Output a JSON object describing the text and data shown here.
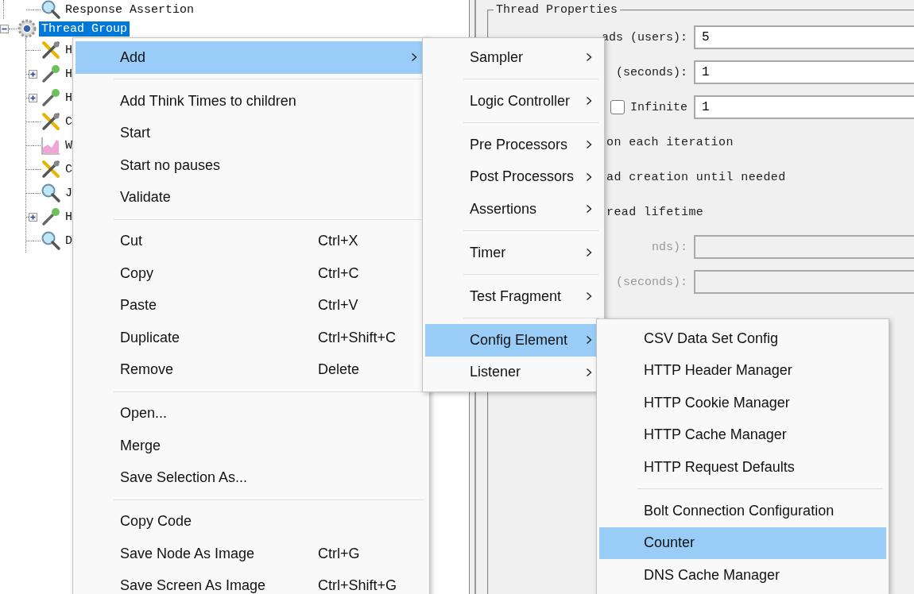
{
  "tree": {
    "partial_branch": [
      {
        "label": "Response Assertion",
        "kind": "magnifier",
        "selected": false
      }
    ],
    "nodes": [
      {
        "label": "Thread Group",
        "kind": "gear",
        "selected": true,
        "expanded": true,
        "children": [
          {
            "label": "H",
            "kind": "tools",
            "selected": false
          },
          {
            "label": "H",
            "kind": "dropper",
            "selected": false,
            "expanded": false
          },
          {
            "label": "H",
            "kind": "dropper",
            "selected": false,
            "expanded": false
          },
          {
            "label": "C",
            "kind": "tools",
            "selected": false
          },
          {
            "label": "W",
            "kind": "chart",
            "selected": false
          },
          {
            "label": "C",
            "kind": "tools",
            "selected": false
          },
          {
            "label": "J",
            "kind": "magnifier",
            "selected": false
          },
          {
            "label": "H",
            "kind": "dropper",
            "selected": false,
            "expanded": false
          },
          {
            "label": "D",
            "kind": "magnifier",
            "selected": false
          }
        ]
      }
    ]
  },
  "properties": {
    "title": "Thread Properties",
    "rows": [
      {
        "kind": "field",
        "label": "ads (users):",
        "value": "5",
        "disabled": false
      },
      {
        "kind": "field",
        "label": "(seconds):",
        "value": "1",
        "disabled": false
      },
      {
        "kind": "checkfield",
        "label": "Infinite",
        "checked": false,
        "value": "1",
        "disabled": false
      },
      {
        "kind": "text",
        "label": "on each iteration"
      },
      {
        "kind": "text",
        "label": "ad creation until needed"
      },
      {
        "kind": "text",
        "label": "read lifetime"
      },
      {
        "kind": "field",
        "label": "nds):",
        "disabled": true
      },
      {
        "kind": "field",
        "label": "(seconds):",
        "disabled": true
      }
    ]
  },
  "menus": [
    {
      "items": [
        {
          "kind": "item",
          "label": "Add",
          "submenu": true,
          "selected": true
        },
        {
          "kind": "separator"
        },
        {
          "kind": "item",
          "label": "Add Think Times to children",
          "submenu": false,
          "selected": false
        },
        {
          "kind": "item",
          "label": "Start",
          "submenu": false,
          "selected": false
        },
        {
          "kind": "item",
          "label": "Start no pauses",
          "submenu": false,
          "selected": false
        },
        {
          "kind": "item",
          "label": "Validate",
          "submenu": false,
          "selected": false
        },
        {
          "kind": "separator"
        },
        {
          "kind": "item",
          "label": "Cut",
          "shortcut": "Ctrl+X",
          "submenu": false,
          "selected": false
        },
        {
          "kind": "item",
          "label": "Copy",
          "shortcut": "Ctrl+C",
          "submenu": false,
          "selected": false
        },
        {
          "kind": "item",
          "label": "Paste",
          "shortcut": "Ctrl+V",
          "submenu": false,
          "selected": false
        },
        {
          "kind": "item",
          "label": "Duplicate",
          "shortcut": "Ctrl+Shift+C",
          "submenu": false,
          "selected": false
        },
        {
          "kind": "item",
          "label": "Remove",
          "shortcut": "Delete",
          "submenu": false,
          "selected": false
        },
        {
          "kind": "separator"
        },
        {
          "kind": "item",
          "label": "Open...",
          "submenu": false,
          "selected": false
        },
        {
          "kind": "item",
          "label": "Merge",
          "submenu": false,
          "selected": false
        },
        {
          "kind": "item",
          "label": "Save Selection As...",
          "submenu": false,
          "selected": false
        },
        {
          "kind": "separator"
        },
        {
          "kind": "item",
          "label": "Copy Code",
          "submenu": false,
          "selected": false
        },
        {
          "kind": "item",
          "label": "Save Node As Image",
          "shortcut": "Ctrl+G",
          "submenu": false,
          "selected": false
        },
        {
          "kind": "item",
          "label": "Save Screen As Image",
          "shortcut": "Ctrl+Shift+G",
          "submenu": false,
          "selected": false
        }
      ]
    },
    {
      "items": [
        {
          "kind": "item",
          "label": "Sampler",
          "submenu": true,
          "selected": false
        },
        {
          "kind": "separator"
        },
        {
          "kind": "item",
          "label": "Logic Controller",
          "submenu": true,
          "selected": false
        },
        {
          "kind": "separator"
        },
        {
          "kind": "item",
          "label": "Pre Processors",
          "submenu": true,
          "selected": false
        },
        {
          "kind": "item",
          "label": "Post Processors",
          "submenu": true,
          "selected": false
        },
        {
          "kind": "item",
          "label": "Assertions",
          "submenu": true,
          "selected": false
        },
        {
          "kind": "separator"
        },
        {
          "kind": "item",
          "label": "Timer",
          "submenu": true,
          "selected": false
        },
        {
          "kind": "separator"
        },
        {
          "kind": "item",
          "label": "Test Fragment",
          "submenu": true,
          "selected": false
        },
        {
          "kind": "separator"
        },
        {
          "kind": "item",
          "label": "Config Element",
          "submenu": true,
          "selected": true
        },
        {
          "kind": "item",
          "label": "Listener",
          "submenu": true,
          "selected": false
        }
      ]
    },
    {
      "items": [
        {
          "kind": "item",
          "label": "CSV Data Set Config",
          "submenu": false,
          "selected": false
        },
        {
          "kind": "item",
          "label": "HTTP Header Manager",
          "submenu": false,
          "selected": false
        },
        {
          "kind": "item",
          "label": "HTTP Cookie Manager",
          "submenu": false,
          "selected": false
        },
        {
          "kind": "item",
          "label": "HTTP Cache Manager",
          "submenu": false,
          "selected": false
        },
        {
          "kind": "item",
          "label": "HTTP Request Defaults",
          "submenu": false,
          "selected": false
        },
        {
          "kind": "separator"
        },
        {
          "kind": "item",
          "label": "Bolt Connection Configuration",
          "submenu": false,
          "selected": false
        },
        {
          "kind": "item",
          "label": "Counter",
          "submenu": false,
          "selected": true
        },
        {
          "kind": "item",
          "label": "DNS Cache Manager",
          "submenu": false,
          "selected": false
        }
      ]
    }
  ]
}
